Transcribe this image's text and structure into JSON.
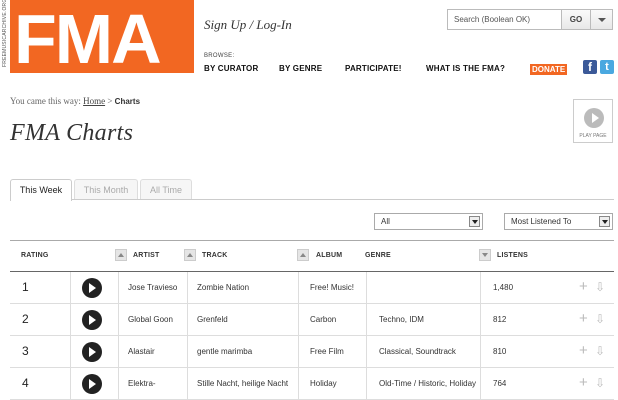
{
  "header": {
    "side_url": "FREEMUSICARCHIVE.ORG",
    "logo_text": "FMA",
    "signup_text": "Sign Up / Log-In",
    "search_placeholder": "Search (Boolean OK)",
    "go_label": "GO",
    "browse_label": "BROWSE:",
    "nav": [
      "BY CURATOR",
      "BY GENRE",
      "PARTICIPATE!",
      "WHAT IS THE FMA?"
    ],
    "donate_label": "DONATE",
    "facebook_glyph": "f",
    "twitter_glyph": "t"
  },
  "breadcrumb": {
    "prefix": "You came this way:",
    "home": "Home",
    "separator": ">",
    "current": "Charts"
  },
  "page_title": "FMA Charts",
  "play_page_label": "PLAY PAGE",
  "tabs": [
    {
      "label": "This Week",
      "active": true
    },
    {
      "label": "This Month",
      "active": false
    },
    {
      "label": "All Time",
      "active": false
    }
  ],
  "filters": {
    "genre_selected": "All",
    "sort_selected": "Most Listened To"
  },
  "table": {
    "headers": {
      "rating": "RATING",
      "artist": "ARTIST",
      "track": "TRACK",
      "album": "ALBUM",
      "genre": "GENRE",
      "listens": "LISTENS"
    },
    "rows": [
      {
        "rank": "1",
        "artist": "Jose Travieso",
        "track": "Zombie Nation",
        "album": "Free! Music!",
        "genre": "",
        "listens": "1,480"
      },
      {
        "rank": "2",
        "artist": "Global Goon",
        "track": "Grenfeld",
        "album": "Carbon",
        "genre": "Techno, IDM",
        "listens": "812"
      },
      {
        "rank": "3",
        "artist": "Alastair",
        "track": "gentle marimba",
        "album": "Free Film",
        "genre": "Classical, Soundtrack",
        "listens": "810"
      },
      {
        "rank": "4",
        "artist": "Elektra-",
        "track": "Stille Nacht, heilige Nacht",
        "album": "Holiday",
        "genre": "Old-Time / Historic, Holiday",
        "listens": "764"
      }
    ]
  },
  "colors": {
    "brand_orange": "#f26722",
    "facebook": "#3b5998",
    "twitter": "#4aa8e0"
  }
}
